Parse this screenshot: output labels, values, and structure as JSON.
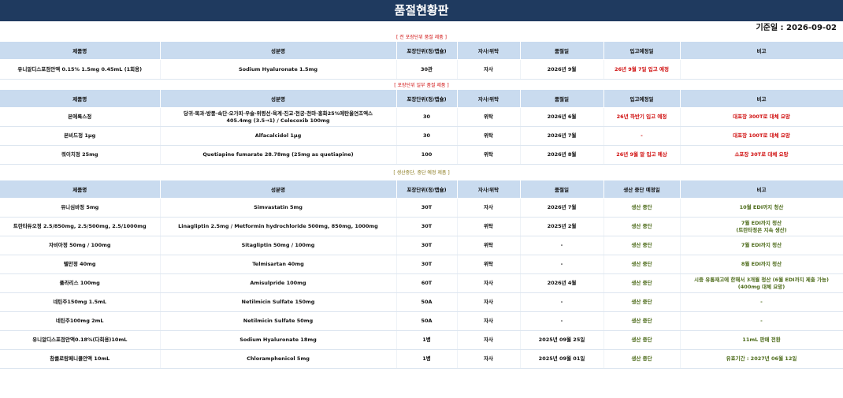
{
  "title": "품절현황판",
  "base_date": "기준일 : 2026-09-02",
  "sections": {
    "s1": "[ 전 포장단위 품절 제품 ]",
    "s2": "[ 포장단위 일부 품절 제품 ]",
    "s3": "[ 생산중단, 중단 예정 제품 ]"
  },
  "headers1": [
    "제품명",
    "성분명",
    "포장단위(정/캡슐)",
    "자사/위탁",
    "품절일",
    "입고예정일",
    "비고"
  ],
  "headers2": [
    "제품명",
    "성분명",
    "포장단위(정/캡슐)",
    "자사/위탁",
    "품절일",
    "입고예정일",
    "비고"
  ],
  "headers3": [
    "제품명",
    "성분명",
    "포장단위(정/캡슐)",
    "자사/위탁",
    "품절일",
    "생산 중단 예정일",
    "비고"
  ],
  "table1": [
    {
      "name": "유니알디스포점안액 0.15% 1.5mg 0.45mL (1회용)",
      "ingredient": "Sodium Hyaluronate 1.5mg",
      "unit": "30관",
      "maker": "자사",
      "soldout": "2026년 9월",
      "arrival": "26년 9월 7일 입고 예정",
      "note": ""
    }
  ],
  "table2": [
    {
      "name": "본에록스정",
      "ingredient1": "당귀·목과·방풍·속단·오가피·우슬·위령선·육계·진교·천궁·천마·홍화25%에탄올연조엑스",
      "ingredient2": "405.4mg (3.5→1) /  Celecoxib 100mg",
      "unit": "30",
      "maker": "위탁",
      "soldout": "2026년 6월",
      "arrival": "26년 하반기 입고 예정",
      "note": "대포장 300T로 대체 요망"
    },
    {
      "name": "본비드정 1μg",
      "ingredient1": "Alfacalcidol 1μg",
      "ingredient2": "",
      "unit": "30",
      "maker": "위탁",
      "soldout": "2026년 7월",
      "arrival": "-",
      "note": "대포장 100T로 대체 요망"
    },
    {
      "name": "쿼이치정 25mg",
      "ingredient1": "Quetiapine fumarate 28.78mg (25mg as quetiapine)",
      "ingredient2": "",
      "unit": "100",
      "maker": "위탁",
      "soldout": "2026년 8월",
      "arrival": "26년 9월 말 입고 예상",
      "note": "소포장 30T로 대체 요망"
    }
  ],
  "table3": [
    {
      "name": "유니심바정 5mg",
      "ingredient": "Simvastatin 5mg",
      "unit": "30T",
      "maker": "자사",
      "soldout": "2026년 7월",
      "stop": "생산 중단",
      "note1": "10월 EDI까지 청산",
      "note2": ""
    },
    {
      "name": "트란타듀오정 2.5/850mg, 2.5/500mg, 2.5/1000mg",
      "ingredient": "Linagliptin 2.5mg / Metformin hydrochloride 500mg, 850mg, 1000mg",
      "unit": "30T",
      "maker": "위탁",
      "soldout": "2025년 2월",
      "stop": "생산 중단",
      "note1": "7월 EDI까지 청산",
      "note2": "(트란타정은 지속 생산)"
    },
    {
      "name": "자비아정 50mg / 100mg",
      "ingredient": "Sitagliptin 50mg / 100mg",
      "unit": "30T",
      "maker": "위탁",
      "soldout": "-",
      "stop": "생산 중단",
      "note1": "7월 EDI까지 청산",
      "note2": ""
    },
    {
      "name": "텔만정 40mg",
      "ingredient": "Telmisartan 40mg",
      "unit": "30T",
      "maker": "위탁",
      "soldout": "-",
      "stop": "생산 중단",
      "note1": "8월 EDI까지 청산",
      "note2": ""
    },
    {
      "name": "풀라리스 100mg",
      "ingredient": "Amisulpride 100mg",
      "unit": "60T",
      "maker": "자사",
      "soldout": "2026년 4월",
      "stop": "생산 중단",
      "note1": "시중 유통재고에 한해서 3개월 청산 (6월 EDI까지 제출 가능)",
      "note2": "(400mg 대체 요망)"
    },
    {
      "name": "네틴주150mg 1.5mL",
      "ingredient": "Netilmicin Sulfate 150mg",
      "unit": "50A",
      "maker": "자사",
      "soldout": "-",
      "stop": "생산 중단",
      "note1": "-",
      "note2": ""
    },
    {
      "name": "네틴주100mg 2mL",
      "ingredient": "Netilmicin Sulfate 50mg",
      "unit": "50A",
      "maker": "자사",
      "soldout": "-",
      "stop": "생산 중단",
      "note1": "-",
      "note2": ""
    },
    {
      "name": "유니알디스포점안액0.18%(다회용)10mL",
      "ingredient": "Sodium Hyaluronate 18mg",
      "unit": "1병",
      "maker": "자사",
      "soldout": "2025년 09월 25일",
      "stop": "생산 중단",
      "note1": "11mL 판매 전환",
      "note2": ""
    },
    {
      "name": "참클로람페니콜안액 10mL",
      "ingredient": "Chloramphenicol 5mg",
      "unit": "1병",
      "maker": "자사",
      "soldout": "2025년 09월 01일",
      "stop": "생산 중단",
      "note1": "유효기간 : 2027년 06월 12일",
      "note2": ""
    }
  ]
}
